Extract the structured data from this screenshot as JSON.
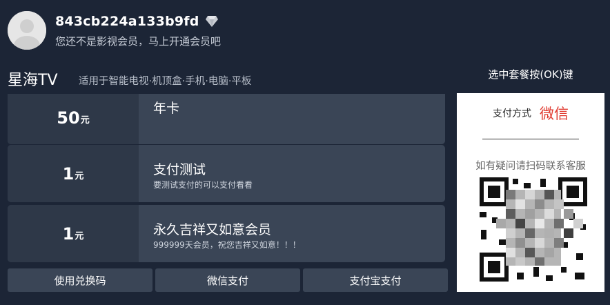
{
  "user": {
    "id": "843cb224a133b9fd",
    "subtitle": "您还不是影视会员，马上开通会员吧",
    "avatar_icon": "default-avatar-icon",
    "vip_icon": "diamond-icon"
  },
  "brand": {
    "name": "星海TV",
    "subtitle": "适用于智能电视·机顶盒·手机·电脑·平板"
  },
  "hint": "选中套餐按(OK)键",
  "plans": [
    {
      "price": "50",
      "unit": "元",
      "name": "年卡",
      "desc": ""
    },
    {
      "price": "1",
      "unit": "元",
      "name": "支付测试",
      "desc": "要测试支付的可以支付看看"
    },
    {
      "price": "1",
      "unit": "元",
      "name": "永久吉祥又如意会员",
      "desc": "999999天会员，祝您吉祥又如意！！！"
    }
  ],
  "buttons": {
    "redeem": "使用兑换码",
    "wechat": "微信支付",
    "alipay": "支付宝支付"
  },
  "payment": {
    "label": "支付方式",
    "method": "微信",
    "contact": "如有疑问请扫码联系客服"
  },
  "colors": {
    "background": "#1c2536",
    "card": "#3a4556",
    "price_box": "#2e3848",
    "accent_red": "#e03a2f"
  }
}
